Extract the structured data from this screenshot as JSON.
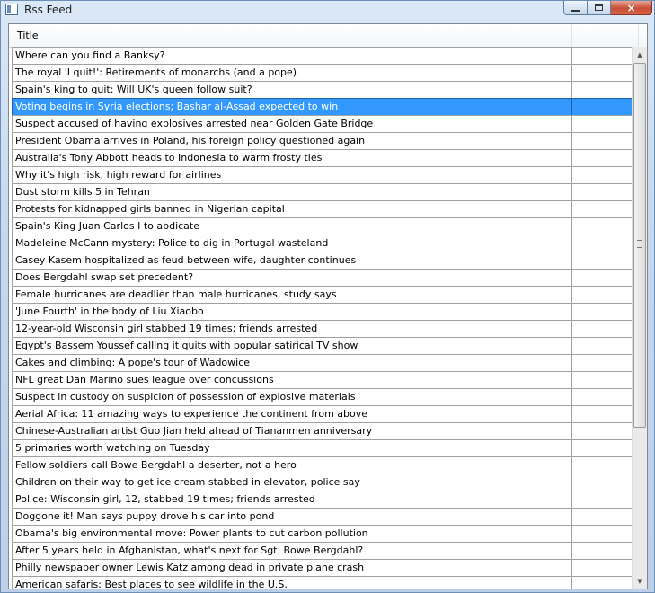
{
  "window": {
    "title": "Rss Feed",
    "caption_buttons": {
      "minimize": "minimize-icon",
      "maximize": "maximize-icon",
      "close": "×"
    }
  },
  "list": {
    "columns": [
      "Title",
      ""
    ],
    "selected_index": 3,
    "rows": [
      "Where can you find a Banksy?",
      "The royal 'I quit!': Retirements of monarchs (and a pope)",
      "Spain's king to quit: Will UK's queen follow suit?",
      "Voting begins in Syria elections; Bashar al-Assad expected to win",
      "Suspect accused of having explosives arrested near Golden Gate Bridge",
      "President Obama arrives in Poland, his foreign policy questioned again",
      "Australia's Tony Abbott heads to Indonesia to warm frosty ties",
      "Why it's high risk, high reward for airlines",
      "Dust storm kills 5 in Tehran",
      "Protests for kidnapped girls banned in Nigerian capital",
      "Spain's King Juan Carlos I to abdicate",
      "Madeleine McCann mystery: Police to dig in Portugal wasteland",
      "Casey Kasem hospitalized as feud between wife, daughter continues",
      "Does Bergdahl swap set precedent?",
      "Female hurricanes are deadlier than male hurricanes, study says",
      "'June Fourth' in the body of Liu Xiaobo",
      "12-year-old Wisconsin girl stabbed 19 times; friends arrested",
      "Egypt's Bassem Youssef calling it quits with popular satirical TV show",
      "Cakes and climbing: A pope's tour of Wadowice",
      "NFL great Dan Marino sues league over concussions",
      "Suspect in custody on suspicion of possession of explosive materials",
      "Aerial Africa: 11 amazing ways to experience the continent from above",
      "Chinese-Australian artist Guo Jian held ahead of Tiananmen anniversary",
      "5 primaries worth watching on Tuesday",
      "Fellow soldiers call Bowe Bergdahl a deserter, not a hero",
      "Children on their way to get ice cream stabbed in elevator, police say",
      "Police: Wisconsin girl, 12, stabbed 19 times; friends arrested",
      "Doggone it! Man says puppy drove his car into pond",
      "Obama's big environmental move: Power plants to cut carbon pollution",
      "After 5 years held in Afghanistan, what's next for Sgt. Bowe Bergdahl?",
      "Philly newspaper owner Lewis Katz among dead in private plane crash",
      "American safaris: Best places to see wildlife in the U.S."
    ]
  },
  "scrollbar": {
    "up_arrow": "▲",
    "down_arrow": "▼"
  },
  "colors": {
    "selection": "#3399ff",
    "selection_text": "#ffffff",
    "grid": "#a0a0a0"
  }
}
